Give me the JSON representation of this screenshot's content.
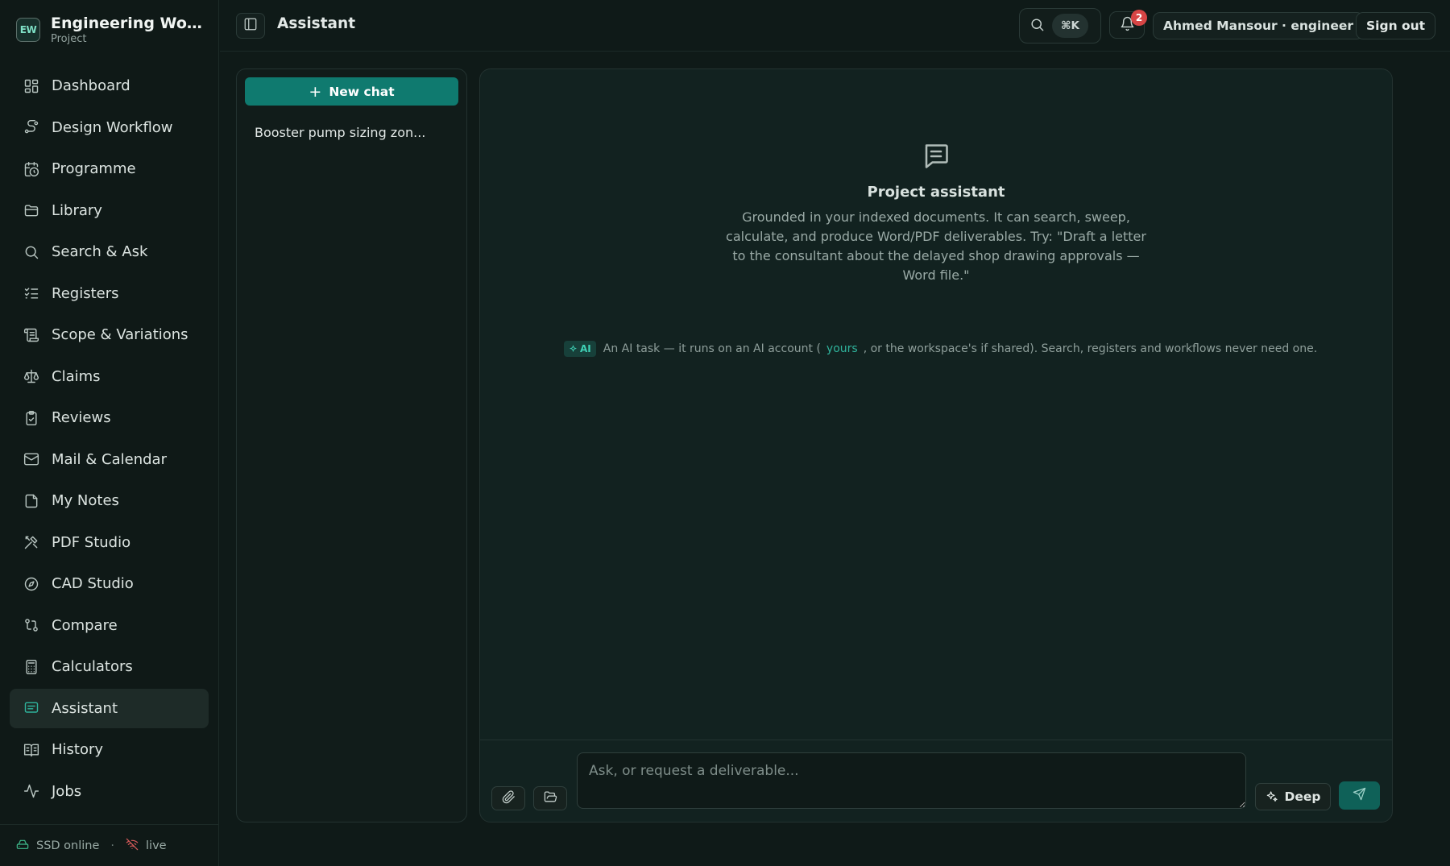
{
  "brand": {
    "name": "Engineering Wor...",
    "subtitle": "Project",
    "logo_text": "EW"
  },
  "sidebar": {
    "items": [
      {
        "label": "Dashboard",
        "icon": "dashboard-icon"
      },
      {
        "label": "Design Workflow",
        "icon": "workflow-icon"
      },
      {
        "label": "Programme",
        "icon": "calendar-clock-icon"
      },
      {
        "label": "Library",
        "icon": "folder-icon"
      },
      {
        "label": "Search & Ask",
        "icon": "search-icon"
      },
      {
        "label": "Registers",
        "icon": "list-checks-icon"
      },
      {
        "label": "Scope & Variations",
        "icon": "scroll-icon"
      },
      {
        "label": "Claims",
        "icon": "scale-icon"
      },
      {
        "label": "Reviews",
        "icon": "clipboard-check-icon"
      },
      {
        "label": "Mail & Calendar",
        "icon": "mail-icon"
      },
      {
        "label": "My Notes",
        "icon": "note-icon"
      },
      {
        "label": "PDF Studio",
        "icon": "tools-icon"
      },
      {
        "label": "CAD Studio",
        "icon": "compass-icon"
      },
      {
        "label": "Compare",
        "icon": "git-compare-icon"
      },
      {
        "label": "Calculators",
        "icon": "calculator-icon"
      },
      {
        "label": "Assistant",
        "icon": "chat-icon",
        "active": true
      },
      {
        "label": "History",
        "icon": "book-icon"
      },
      {
        "label": "Jobs",
        "icon": "activity-icon"
      }
    ],
    "footer": {
      "storage_status": "SSD online",
      "separator": "·",
      "live_status": "live"
    }
  },
  "topbar": {
    "title": "Assistant",
    "shortcut": "⌘K",
    "notification_count": "2",
    "user": "Ahmed Mansour · engineer",
    "signout_label": "Sign out"
  },
  "chats": {
    "new_chat_label": "New chat",
    "items": [
      "Booster pump sizing zon..."
    ]
  },
  "assistant": {
    "title": "Project assistant",
    "description": "Grounded in your indexed documents. It can search, sweep, calculate, and produce Word/PDF deliverables. Try: \"Draft a letter to the consultant about the delayed shop drawing approvals — Word file.\"",
    "ai_badge": "AI",
    "ai_note_before": "An AI task — it runs on an AI account (",
    "ai_note_link": "yours",
    "ai_note_after": ", or the workspace's if shared). Search, registers and workflows never need one.",
    "input_placeholder": "Ask, or request a deliverable...",
    "deep_label": "Deep"
  },
  "colors": {
    "accent": "#0f7a6f",
    "accent_text": "#2fb39c",
    "badge": "#d64545",
    "background": "#0f1a18"
  }
}
